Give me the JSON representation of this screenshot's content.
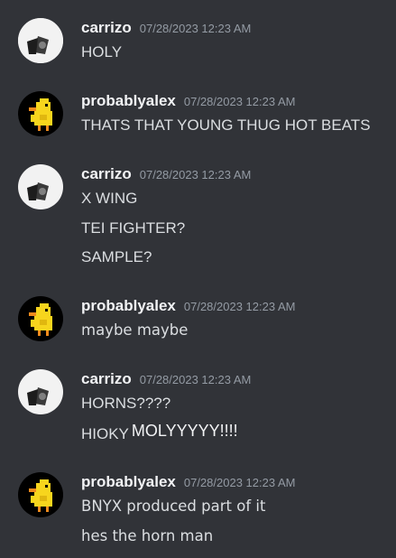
{
  "messages": [
    {
      "author": "carrizo",
      "timestamp": "07/28/2023 12:23 AM",
      "lines": [
        "HOLY"
      ]
    },
    {
      "author": "probablyalex",
      "timestamp": "07/28/2023 12:23 AM",
      "lines": [
        "THATS THAT YOUNG THUG HOT BEATS"
      ]
    },
    {
      "author": "carrizo",
      "timestamp": "07/28/2023 12:23 AM",
      "lines": [
        "X WING",
        "TEI FIGHTER?",
        "SAMPLE?"
      ]
    },
    {
      "author": "probablyalex",
      "timestamp": "07/28/2023 12:23 AM",
      "lines": [
        "maybe maybe"
      ]
    },
    {
      "author": "carrizo",
      "timestamp": "07/28/2023 12:23 AM",
      "lines": [
        "HORNS????",
        "HIOKY"
      ],
      "extra": "MOLYYYYY!!!!"
    },
    {
      "author": "probablyalex",
      "timestamp": "07/28/2023 12:23 AM",
      "lines": [
        "BNYX produced part of it",
        "hes the horn man"
      ]
    }
  ],
  "avatars": {
    "carrizo": "grayscale-photo-avatar",
    "probablyalex": "pixel-duck-avatar"
  },
  "colors": {
    "background": "#313338",
    "username": "#f2f3f5",
    "timestamp": "#949ba4",
    "message_text": "#dbdee1",
    "duck_yellow": "#f7d51d",
    "duck_orange": "#f08a1c"
  }
}
